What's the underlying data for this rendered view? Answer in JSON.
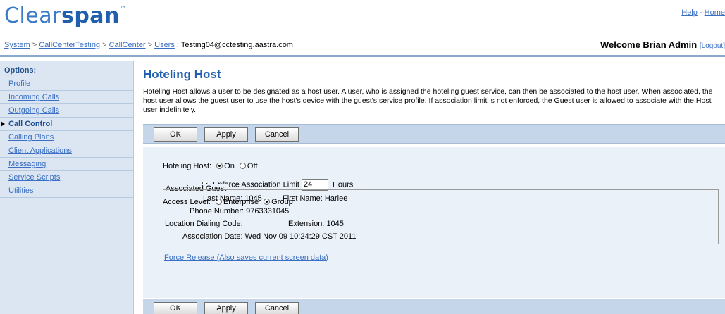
{
  "header": {
    "logo": {
      "part1": "Clear",
      "part2": "span",
      "tm": "™"
    },
    "links": {
      "help": "Help",
      "sep": " - ",
      "home": "Home"
    }
  },
  "breadcrumb": {
    "items": [
      "System",
      "CallCenterTesting",
      "CallCenter",
      "Users"
    ],
    "separator": " > ",
    "current_prefix": " : ",
    "current": "Testing04@cctesting.aastra.com"
  },
  "welcome": {
    "text": "Welcome Brian Admin ",
    "logout": "[Logout]"
  },
  "sidebar": {
    "title": "Options:",
    "items": [
      {
        "label": "Profile"
      },
      {
        "label": "Incoming Calls"
      },
      {
        "label": "Outgoing Calls"
      },
      {
        "label": "Call Control",
        "active": true
      },
      {
        "label": "Calling Plans"
      },
      {
        "label": "Client Applications"
      },
      {
        "label": "Messaging"
      },
      {
        "label": "Service Scripts"
      },
      {
        "label": "Utilities"
      }
    ]
  },
  "page": {
    "title": "Hoteling Host",
    "description": "Hoteling Host allows a user to be designated as a host user. A user, who is assigned the hoteling guest service, can then be associated to the host user. When associated, the host user allows the guest user to use the host's device with the guest's service profile. If association limit is not enforced, the Guest user is allowed to associate with the Host user indefinitely."
  },
  "buttons": {
    "ok": "OK",
    "apply": "Apply",
    "cancel": "Cancel"
  },
  "form": {
    "hoteling_host_label": "Hoteling Host:",
    "on_label": "On",
    "off_label": "Off",
    "hoteling_host_value": "On",
    "enforce_label": "Enforce Association Limit",
    "enforce_checked": true,
    "limit_value": "24",
    "hours_label": "Hours",
    "access_level_label": "Access Level:",
    "enterprise_label": "Enterprise",
    "group_label": "Group",
    "access_level_value": "Group"
  },
  "associated_guest": {
    "legend": "Associated Guest",
    "last_name_label": "Last Name:",
    "last_name": "1045",
    "first_name_label": "First Name:",
    "first_name": "Harlee",
    "phone_label": "Phone Number:",
    "phone": "9763331045",
    "location_label": "Location Dialing Code:",
    "location": "",
    "extension_label": "Extension:",
    "extension": "1045",
    "date_label": "Association Date:",
    "date": "Wed Nov 09 10:24:29 CST 2011"
  },
  "force_release": "Force Release (Also saves current screen data)",
  "colors": {
    "brand": "#1f5fad",
    "link": "#3a6fc4",
    "sidebar_bg": "#dbe6f2",
    "button_bar": "#c6d6ea",
    "form_bg": "#eaf1f9"
  }
}
